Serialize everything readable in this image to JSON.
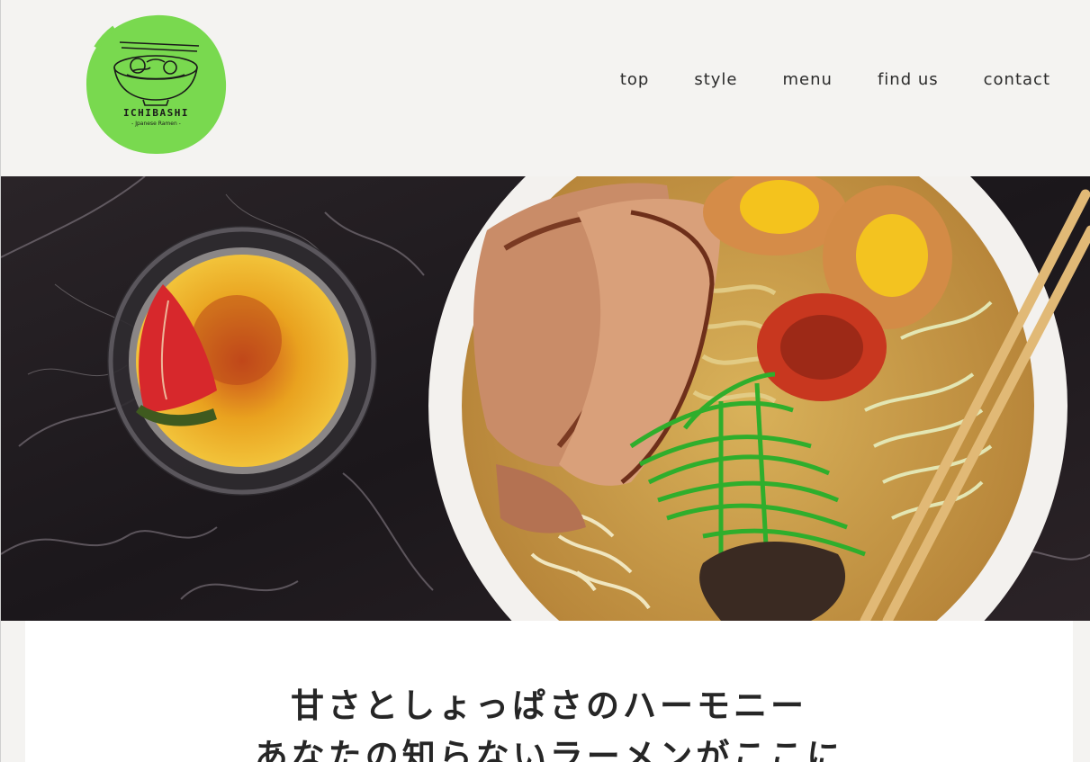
{
  "brand": {
    "name": "ICHIBASHI",
    "tagline": "- Jpanese Ramen -",
    "accent_color": "#79d94f"
  },
  "nav": {
    "items": [
      {
        "label": "top"
      },
      {
        "label": "style"
      },
      {
        "label": "menu"
      },
      {
        "label": "find us"
      },
      {
        "label": "contact"
      }
    ]
  },
  "hero": {
    "image": "ramen-bowl-and-creme-brulee-photo"
  },
  "main": {
    "headline_line1": "甘さとしょっぱさのハーモニー",
    "headline_line2": "あなたの知らないラーメンがここに"
  }
}
